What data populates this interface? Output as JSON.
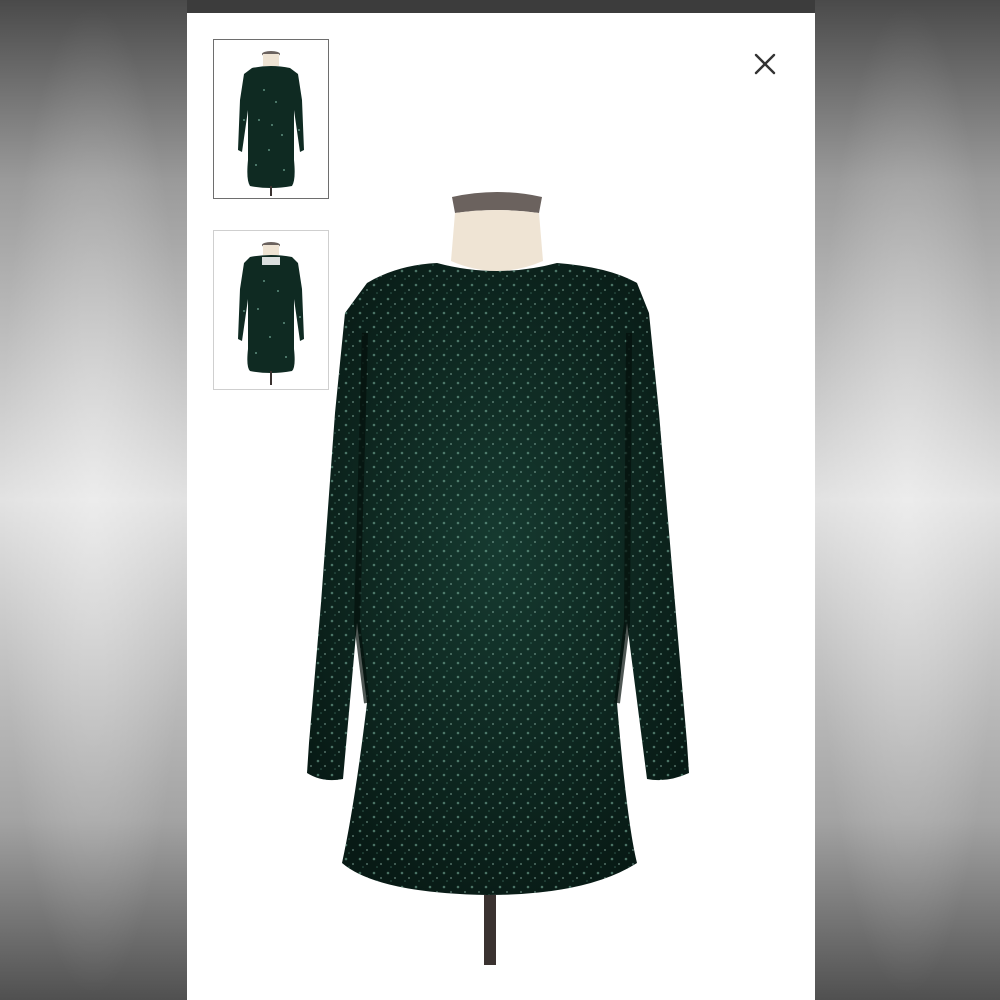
{
  "viewer": {
    "close_icon": "close-icon",
    "thumbnails": [
      {
        "view": "front",
        "selected": true
      },
      {
        "view": "back",
        "selected": false
      }
    ],
    "main_image": {
      "view": "front"
    }
  },
  "colors": {
    "panel_background": "#ffffff",
    "top_bar": "#3c3c3c",
    "dress": "#0f2a22",
    "sequin_highlight": "#7fb8a4",
    "mannequin": "#efe4d4",
    "mannequin_cap": "#6b625e",
    "stand": "#3a3230"
  }
}
